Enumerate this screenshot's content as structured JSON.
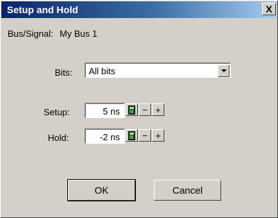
{
  "window": {
    "title": "Setup and Hold",
    "close_glyph": "X"
  },
  "bus_signal": {
    "label": "Bus/Signal:",
    "value": "My Bus 1"
  },
  "bits": {
    "label": "Bits:",
    "selected": "All bits"
  },
  "setup": {
    "label": "Setup:",
    "value": "5 ns"
  },
  "hold": {
    "label": "Hold:",
    "value": "-2 ns"
  },
  "stepper": {
    "minus": "−",
    "plus": "+",
    "icon": "calculator-icon"
  },
  "buttons": {
    "ok": "OK",
    "cancel": "Cancel"
  }
}
